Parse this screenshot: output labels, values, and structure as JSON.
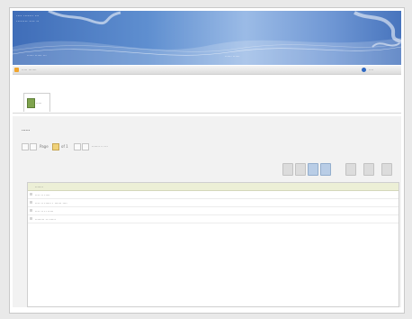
{
  "header": {
    "app_title_line1": "···· ······· ···",
    "app_title_line2": "········ ···· ··",
    "subtitle": "······ ······ ···",
    "caption": "······ ······"
  },
  "menubar": {
    "menu_label": "····· ·······",
    "logout_label": "····"
  },
  "tabs": [
    {
      "label": "·····"
    }
  ],
  "section": {
    "title": "······"
  },
  "pager": {
    "page_label": "Page",
    "page_value": "1",
    "of_label": "of 1",
    "range_text": "······· ·· ···"
  },
  "toolbar": {
    "icons": [
      "print-icon",
      "export-icon",
      "edit-icon",
      "add-icon",
      "view-icon",
      "copy-icon",
      "delete-icon"
    ]
  },
  "grid": {
    "header_label": "·······",
    "rows": [
      {
        "text": "···· ·· ·····"
      },
      {
        "text": "···· ·· ······ · ······ ····"
      },
      {
        "text": "···· ·· ·· ·····"
      },
      {
        "text": "········ ·· ······"
      }
    ]
  },
  "colors": {
    "banner": "#5f8fd0",
    "menu_accent": "#f1a52c",
    "grid_header": "#ecefd6"
  }
}
